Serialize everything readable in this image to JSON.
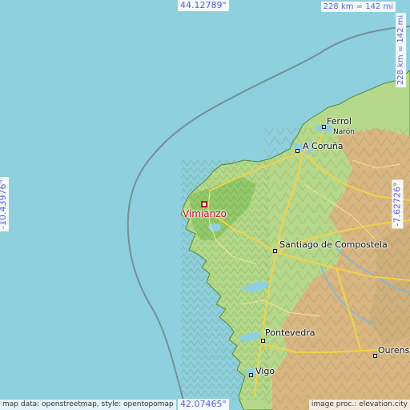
{
  "map": {
    "selected_place": "Vimianzo",
    "coords": {
      "north": "44.12789°",
      "south": "42.07465°",
      "west": "-10.43976°",
      "east": "-7.62726°"
    },
    "scale": {
      "horizontal": "228 km = 142 mi",
      "vertical": "228 km = 142 mi"
    },
    "places": [
      {
        "name": "Ferrol",
        "size": "big"
      },
      {
        "name": "Narón",
        "size": "small"
      },
      {
        "name": "A Coruña",
        "size": "big"
      },
      {
        "name": "Santiago de Compostela",
        "size": "big"
      },
      {
        "name": "Pontevedra",
        "size": "big"
      },
      {
        "name": "Vigo",
        "size": "big"
      },
      {
        "name": "Ourense",
        "size": "big"
      }
    ],
    "attribution": {
      "left": "map data: openstreetmap, style: opentopomap",
      "right": "image proc.: elevation.city"
    },
    "colors": {
      "sea": "#8fd0df",
      "lowland": "#a8d67a",
      "highland": "#d8b682",
      "road": "#f3d24a",
      "coord_text": "#5b5fe0",
      "marker": "#c8102e"
    }
  }
}
